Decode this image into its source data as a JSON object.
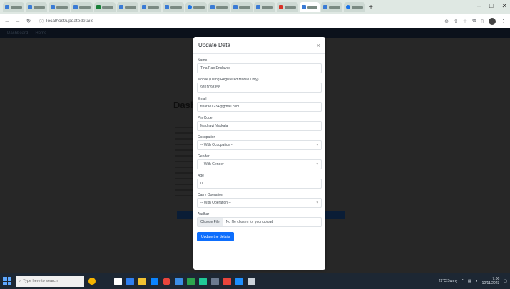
{
  "browser": {
    "address_url": "localhost/updatedetails",
    "tab_count": 17
  },
  "app_nav": {
    "items": [
      "Dashboard",
      "Home"
    ]
  },
  "background": {
    "title": "Dash"
  },
  "modal": {
    "title": "Update Data",
    "close_label": "×",
    "fields": [
      {
        "label": "Name",
        "value": "Tina Rao Enclaves",
        "type": "text"
      },
      {
        "label": "Mobile (Using Registered Mobile Only)",
        "value": "9701093358",
        "type": "text"
      },
      {
        "label": "Email",
        "value": "tinarao1234@gmail.com",
        "type": "text"
      },
      {
        "label": "Pin Code",
        "value": "Madhavi Nakkala",
        "type": "text"
      },
      {
        "label": "Occupation",
        "value": "-- With Occupation --",
        "type": "select"
      },
      {
        "label": "Gender",
        "value": "-- With Gender --",
        "type": "select"
      },
      {
        "label": "Age",
        "value": "0",
        "type": "text"
      },
      {
        "label": "Carry Operation",
        "value": "-- With Operation --",
        "type": "select"
      },
      {
        "label": "Aadhar",
        "value": "",
        "type": "file",
        "file_button": "Choose File",
        "file_text": "No file chosen for your upload"
      }
    ],
    "submit_label": "Update the details"
  },
  "taskbar": {
    "search_placeholder": "Type here to search",
    "weather": "29°C Sunny",
    "time": "7:00",
    "date": "10/11/2023"
  }
}
